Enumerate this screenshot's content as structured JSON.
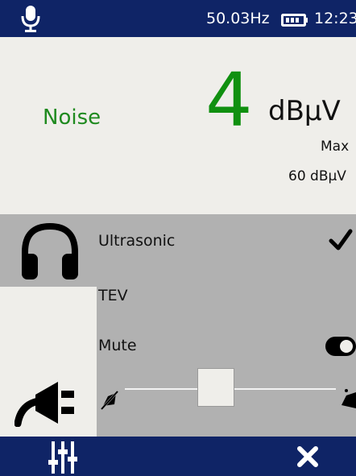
{
  "status_bar": {
    "frequency": "50.03Hz",
    "time": "12:23",
    "icons": [
      "microphone-icon",
      "battery-icon"
    ]
  },
  "reading": {
    "mode_label": "Noise",
    "value": "4",
    "unit": "dBµV",
    "max_label": "Max",
    "max_value": "60 dBµV"
  },
  "options": {
    "ultrasonic_label": "Ultrasonic",
    "ultrasonic_checked": true,
    "tev_label": "TEV",
    "mute_label": "Mute",
    "mute_on": false
  },
  "volume": {
    "level": 0.43
  },
  "tabs": [
    {
      "icon": "headphones-icon",
      "selected": true
    },
    {
      "icon": "power-plug-icon",
      "selected": false
    }
  ],
  "bottom_bar": {
    "icons": [
      "equalizer-icon",
      "close-icon"
    ]
  },
  "colors": {
    "bar": "#0f2466",
    "reading_green": "#109010",
    "panel_gray": "#b1b1b1",
    "background": "#efeeea"
  }
}
